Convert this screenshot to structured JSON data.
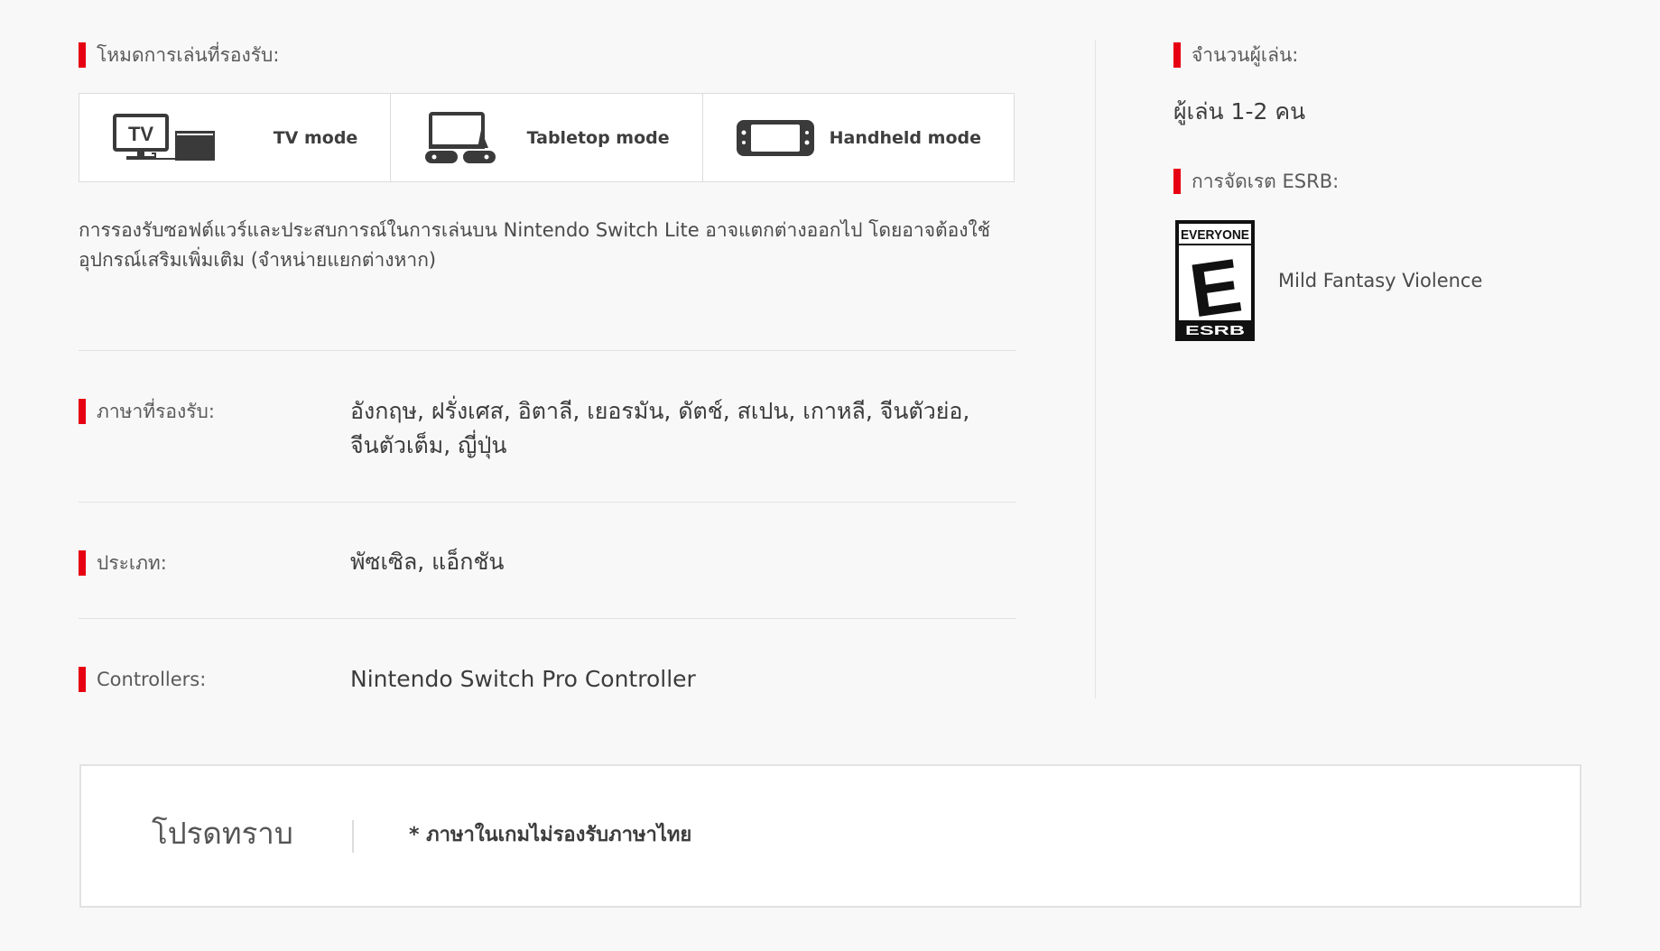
{
  "play_modes": {
    "label": "โหมดการเล่นที่รองรับ:",
    "tv": {
      "icon": "tv-mode-icon",
      "icon_text": "TV",
      "label": "TV mode"
    },
    "tabletop": {
      "icon": "tabletop-mode-icon",
      "label": "Tabletop mode"
    },
    "handheld": {
      "icon": "handheld-mode-icon",
      "label": "Handheld mode"
    }
  },
  "lite_note": "การรองรับซอฟต์แวร์และประสบการณ์ในการเล่นบน Nintendo Switch Lite อาจแตกต่างออกไป โดยอาจต้องใช้อุปกรณ์เสริมเพิ่มเติม (จำหน่ายแยกต่างหาก)",
  "details": {
    "languages": {
      "label": "ภาษาที่รองรับ:",
      "value": "อังกฤษ, ฝรั่งเศส, อิตาลี, เยอรมัน, ดัตช์, สเปน, เกาหลี, จีนตัวย่อ, จีนตัวเต็ม, ญี่ปุ่น"
    },
    "genre": {
      "label": "ประเภท:",
      "value": "พัซเซิล, แอ็กชัน"
    },
    "controllers": {
      "label": "Controllers:",
      "value": "Nintendo Switch Pro Controller"
    }
  },
  "sidebar": {
    "players_label": "จำนวนผู้เล่น:",
    "players_value": "ผู้เล่น 1-2 คน",
    "esrb_label": "การจัดเรต ESRB:",
    "esrb_badge": {
      "icon": "esrb-everyone-badge",
      "top_text": "EVERYONE",
      "letter": "E",
      "bottom_text": "ESRB"
    },
    "esrb_descriptor": "Mild Fantasy Violence"
  },
  "notice": {
    "title": "โปรดทราบ",
    "text": "* ภาษาในเกมไม่รองรับภาษาไทย"
  },
  "colors": {
    "accent": "#e60012",
    "background": "#f8f8f8",
    "text": "#3c3c3c"
  }
}
